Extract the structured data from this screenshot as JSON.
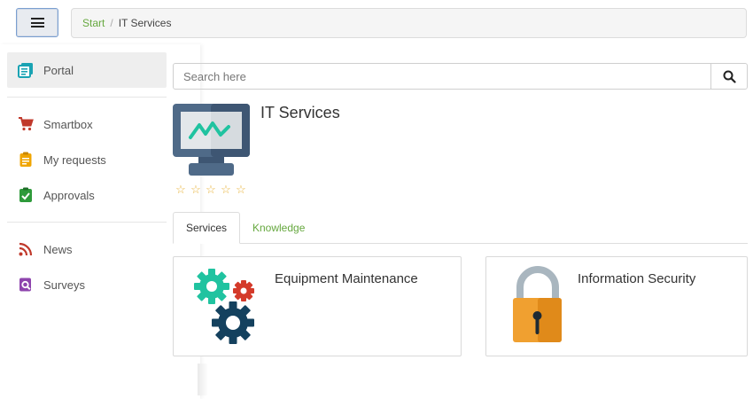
{
  "header": {
    "menu_icon": "hamburger-menu-icon",
    "breadcrumb": {
      "home": "Start",
      "separator": "/",
      "current": "IT Services"
    }
  },
  "sidebar": {
    "groups": [
      [
        {
          "label": "Portal",
          "icon": "portal-book-icon",
          "color": "#1aa3b3",
          "active": true
        }
      ],
      [
        {
          "label": "Smartbox",
          "icon": "cart-icon",
          "color": "#c0392b"
        },
        {
          "label": "My requests",
          "icon": "clipboard-icon",
          "color": "#f0a500"
        },
        {
          "label": "Approvals",
          "icon": "check-badge-icon",
          "color": "#2e9a3a"
        }
      ],
      [
        {
          "label": "News",
          "icon": "rss-icon",
          "color": "#c0392b"
        },
        {
          "label": "Surveys",
          "icon": "survey-search-icon",
          "color": "#8e44ad"
        }
      ]
    ]
  },
  "search": {
    "placeholder": "Search here",
    "value": "",
    "icon": "search-icon"
  },
  "service": {
    "title": "IT Services",
    "icon": "monitor-icon",
    "rating": 0,
    "max_rating": 5
  },
  "tabs": [
    {
      "label": "Services",
      "active": true
    },
    {
      "label": "Knowledge",
      "active": false
    }
  ],
  "cards": [
    {
      "title": "Equipment Maintenance",
      "icon": "gears-icon"
    },
    {
      "title": "Information Security",
      "icon": "padlock-icon"
    }
  ],
  "colors": {
    "accent_green": "#66a83f",
    "star": "#e8b33a",
    "navy": "#14415e",
    "teal": "#20c3a0",
    "red": "#d43a2a",
    "orange": "#f0a030"
  }
}
